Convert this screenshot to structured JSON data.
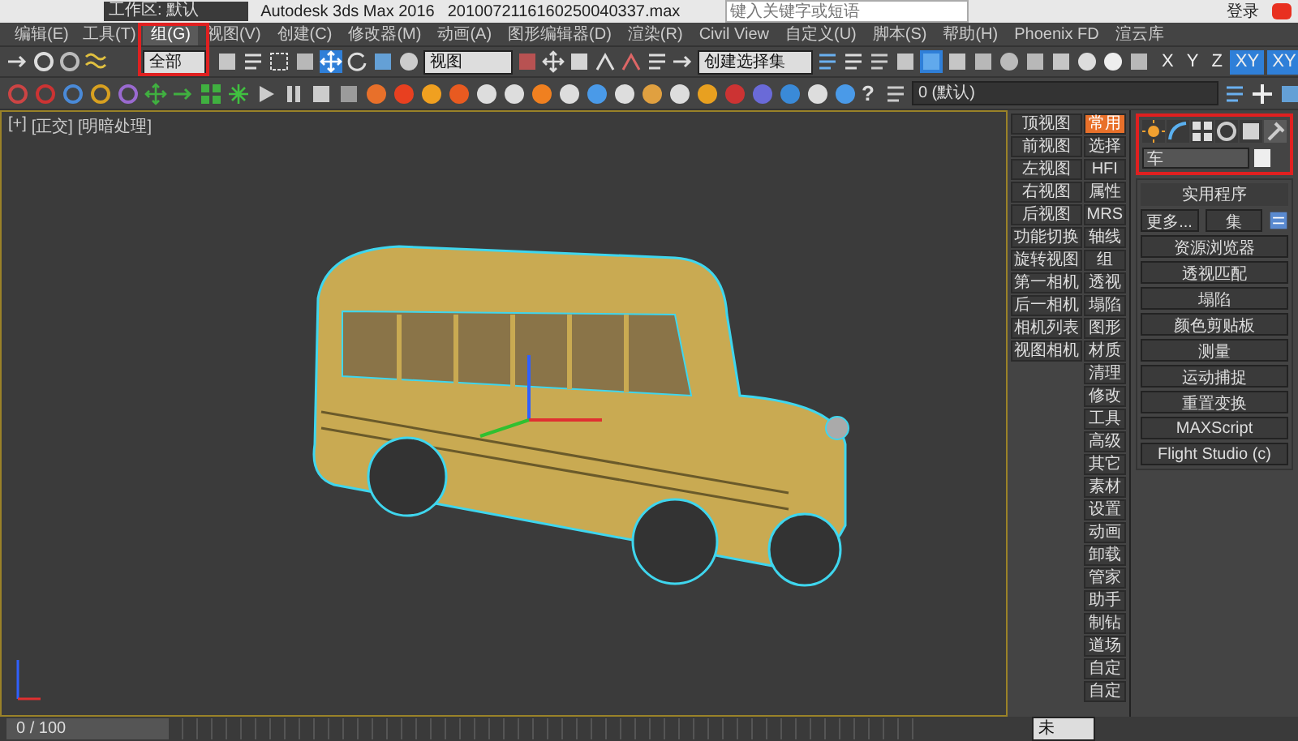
{
  "title_bar": {
    "workspace": "工作区: 默认",
    "app_title": "Autodesk 3ds Max 2016",
    "file_name": "2010072116160250040337.max",
    "search": {
      "placeholder": "键入关键字或短语"
    },
    "sign_in": "登录"
  },
  "menu": [
    {
      "label": "编辑(E)",
      "selected": false
    },
    {
      "label": "工具(T)",
      "selected": false
    },
    {
      "label": "组(G)",
      "selected": true
    },
    {
      "label": "视图(V)",
      "selected": false
    },
    {
      "label": "创建(C)",
      "selected": false
    },
    {
      "label": "修改器(M)",
      "selected": false
    },
    {
      "label": "动画(A)",
      "selected": false
    },
    {
      "label": "图形编辑器(D)",
      "selected": false
    },
    {
      "label": "渲染(R)",
      "selected": false
    },
    {
      "label": "Civil View",
      "selected": false
    },
    {
      "label": "自定义(U)",
      "selected": false
    },
    {
      "label": "脚本(S)",
      "selected": false
    },
    {
      "label": "帮助(H)",
      "selected": false
    },
    {
      "label": "Phoenix FD",
      "selected": false
    },
    {
      "label": "渲云库",
      "selected": false
    }
  ],
  "main_toolbar": {
    "selection_filter": "全部",
    "reference_coord": "视图",
    "named_selection": "创建选择集",
    "axis_buttons": [
      {
        "label": "X",
        "selected": false
      },
      {
        "label": "Y",
        "selected": false
      },
      {
        "label": "Z",
        "selected": false
      },
      {
        "label": "XY",
        "selected": true
      },
      {
        "label": "XY",
        "selected": true
      }
    ]
  },
  "layer_toolbar": {
    "layer": "0 (默认)",
    "help": "?"
  },
  "viewport": {
    "labels": [
      "[+]",
      "[正交]",
      "[明暗处理]"
    ]
  },
  "view_buttons": [
    "顶视图",
    "前视图",
    "左视图",
    "右视图",
    "后视图",
    "功能切换",
    "旋转视图",
    "第一相机",
    "后一相机",
    "相机列表",
    "视图相机"
  ],
  "tool_tabs": [
    {
      "label": "常用",
      "selected": true
    },
    {
      "label": "选择",
      "selected": false
    },
    {
      "label": "HFI",
      "selected": false
    },
    {
      "label": "属性",
      "selected": false
    },
    {
      "label": "MRS",
      "selected": false
    },
    {
      "label": "轴线",
      "selected": false
    },
    {
      "label": "组",
      "selected": false
    },
    {
      "label": "透视",
      "selected": false
    },
    {
      "label": "塌陷",
      "selected": false
    },
    {
      "label": "图形",
      "selected": false
    },
    {
      "label": "材质",
      "selected": false
    },
    {
      "label": "清理",
      "selected": false
    },
    {
      "label": "修改",
      "selected": false
    },
    {
      "label": "工具",
      "selected": false
    },
    {
      "label": "高级",
      "selected": false
    },
    {
      "label": "其它",
      "selected": false
    },
    {
      "label": "素材",
      "selected": false
    },
    {
      "label": "设置",
      "selected": false
    },
    {
      "label": "动画",
      "selected": false
    },
    {
      "label": "卸载",
      "selected": false
    },
    {
      "label": "管家",
      "selected": false
    },
    {
      "label": "助手",
      "selected": false
    },
    {
      "label": "制钻",
      "selected": false
    },
    {
      "label": "道场",
      "selected": false
    },
    {
      "label": "自定",
      "selected": false
    },
    {
      "label": "自定",
      "selected": false
    }
  ],
  "command_panel": {
    "tabs": [
      {
        "kind": "create",
        "selected": false
      },
      {
        "kind": "modify",
        "selected": false
      },
      {
        "kind": "hierarchy",
        "selected": false
      },
      {
        "kind": "motion",
        "selected": false
      },
      {
        "kind": "display",
        "selected": false
      },
      {
        "kind": "utilities",
        "selected": true
      }
    ],
    "object_name": "车",
    "rollout_title": "实用程序",
    "more_button": "更多...",
    "sets_button": "集",
    "utilities": [
      "资源浏览器",
      "透视匹配",
      "塌陷",
      "颜色剪贴板",
      "测量",
      "运动捕捉",
      "重置变换",
      "MAXScript",
      "Flight Studio (c)"
    ]
  },
  "timeline": {
    "position": "0 / 100",
    "level": 0
  },
  "status": {
    "dropdown": "未"
  }
}
